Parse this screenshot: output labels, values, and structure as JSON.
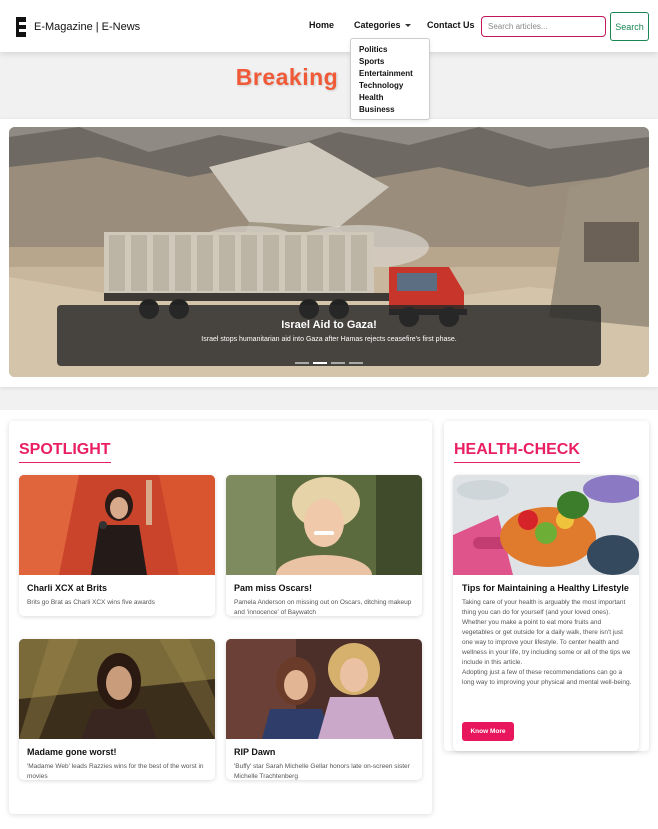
{
  "navbar": {
    "brand": "E-Magazine | E-News",
    "links": {
      "home": "Home",
      "categories": "Categories",
      "contact": "Contact Us"
    },
    "search": {
      "placeholder": "Search articles...",
      "button": "Search"
    },
    "dropdown": [
      "Politics",
      "Sports",
      "Entertainment",
      "Technology",
      "Health",
      "Business"
    ]
  },
  "breaking": {
    "title": "Breaking",
    "slide": {
      "title": "Israel Aid to Gaza!",
      "text": "Israel stops humanitarian aid into Gaza after Hamas rejects ceasefire's first phase."
    },
    "indicators": {
      "count": 4,
      "active_index": 1
    }
  },
  "spotlight": {
    "title": "SPOTLIGHT",
    "cards": [
      {
        "title": "Charli XCX at Brits",
        "text": "Brits go Brat as Charli XCX wins five awards"
      },
      {
        "title": "Pam miss Oscars!",
        "text": "Pamela Anderson on missing out on Oscars, ditching makeup and 'innocence' of Baywatch"
      },
      {
        "title": "Madame gone worst!",
        "text": "'Madame Web' leads Razzies wins for the best of the worst in movies"
      },
      {
        "title": "RIP Dawn",
        "text": "'Buffy' star Sarah Michelle Gellar honors late on-screen sister Michelle Trachtenberg"
      }
    ]
  },
  "health": {
    "title": "HEALTH-CHECK",
    "card": {
      "title": "Tips for Maintaining a Healthy Lifestyle",
      "paragraphs": [
        "Taking care of your health is arguably the most important thing you can do for yourself (and your loved ones).",
        "Whether you make a point to eat more fruits and vegetables or get outside for a daily walk, there isn't just one way to improve your lifestyle. To center health and wellness in your life, try including some or all of the tips we include in this article.",
        "Adopting just a few of these recommendations can go a long way to improving your physical and mental well-being."
      ],
      "button": "Know More"
    }
  },
  "colors": {
    "accent": "#e91e63",
    "breaking": "#f05a37",
    "search_border": "#c2185b",
    "search_button": "#198754"
  }
}
